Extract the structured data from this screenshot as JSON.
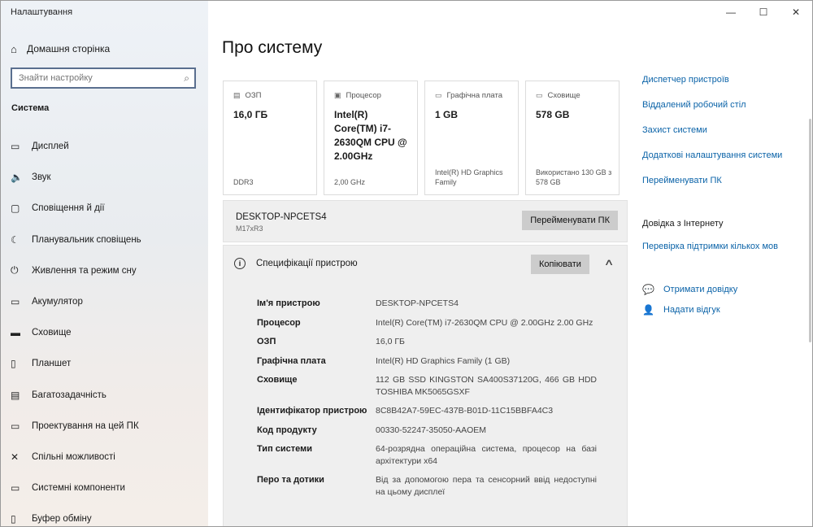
{
  "app": {
    "title": "Налаштування"
  },
  "window_controls": {
    "minimize": "—",
    "maximize": "☐",
    "close": "✕"
  },
  "sidebar": {
    "home_label": "Домашня сторінка",
    "search_placeholder": "Знайти настройку",
    "section_title": "Система",
    "items": [
      {
        "label": "Дисплей",
        "icon": "display-icon",
        "glyph": "▭"
      },
      {
        "label": "Звук",
        "icon": "sound-icon",
        "glyph": "🔈"
      },
      {
        "label": "Сповіщення й дії",
        "icon": "notifications-icon",
        "glyph": "▢"
      },
      {
        "label": "Планувальник сповіщень",
        "icon": "focus-assist-icon",
        "glyph": "☾"
      },
      {
        "label": "Живлення та режим сну",
        "icon": "power-icon",
        "glyph": "⏻"
      },
      {
        "label": "Акумулятор",
        "icon": "battery-icon",
        "glyph": "▭"
      },
      {
        "label": "Сховище",
        "icon": "storage-icon",
        "glyph": "▬"
      },
      {
        "label": "Планшет",
        "icon": "tablet-icon",
        "glyph": "▯"
      },
      {
        "label": "Багатозадачність",
        "icon": "multitasking-icon",
        "glyph": "▤"
      },
      {
        "label": "Проектування на цей ПК",
        "icon": "projecting-icon",
        "glyph": "▭"
      },
      {
        "label": "Спільні можливості",
        "icon": "shared-experiences-icon",
        "glyph": "✕"
      },
      {
        "label": "Системні компоненти",
        "icon": "system-components-icon",
        "glyph": "▭"
      },
      {
        "label": "Буфер обміну",
        "icon": "clipboard-icon",
        "glyph": "▯"
      }
    ]
  },
  "main": {
    "title": "Про систему",
    "cards": [
      {
        "label": "ОЗП",
        "value": "16,0 ГБ",
        "sub": "DDR3",
        "icon": "ram-icon",
        "glyph": "▤"
      },
      {
        "label": "Процесор",
        "value": "Intel(R) Core(TM) i7-2630QM CPU @ 2.00GHz",
        "sub": "2,00 GHz",
        "icon": "processor-icon",
        "glyph": "▣"
      },
      {
        "label": "Графічна плата",
        "value": "1 GB",
        "sub": "Intel(R) HD Graphics Family",
        "icon": "graphics-icon",
        "glyph": "▭"
      },
      {
        "label": "Сховище",
        "value": "578 GB",
        "sub": "Використано 130 GB з 578 GB",
        "icon": "storage-icon",
        "glyph": "▭"
      }
    ],
    "device": {
      "name": "DESKTOP-NPCETS4",
      "model": "M17xR3",
      "rename_label": "Перейменувати ПК"
    },
    "specs": {
      "title": "Специфікації пристрою",
      "copy_label": "Копіювати",
      "rows": [
        {
          "key": "Ім'я пристрою",
          "value": "DESKTOP-NPCETS4"
        },
        {
          "key": "Процесор",
          "value": "Intel(R) Core(TM) i7-2630QM CPU @ 2.00GHz 2.00 GHz"
        },
        {
          "key": "ОЗП",
          "value": "16,0 ГБ"
        },
        {
          "key": "Графічна плата",
          "value": "Intel(R) HD Graphics Family (1 GB)"
        },
        {
          "key": "Сховище",
          "value": "112 GB SSD KINGSTON SA400S37120G, 466 GB HDD TOSHIBA MK5065GSXF"
        },
        {
          "key": "Ідентифікатор пристрою",
          "value": "8C8B42A7-59EC-437B-B01D-11C15BBFA4C3"
        },
        {
          "key": "Код продукту",
          "value": "00330-52247-35050-AAOEM"
        },
        {
          "key": "Тип системи",
          "value": "64-розрядна операційна система, процесор на базі архітектури x64"
        },
        {
          "key": "Перо та дотики",
          "value": "Від за допомогою пера та сенсорний ввід недоступні на цьому дисплеї"
        }
      ]
    }
  },
  "right": {
    "links": [
      "Диспетчер пристроїв",
      "Віддалений робочий стіл",
      "Захист системи",
      "Додаткові налаштування системи",
      "Перейменувати ПК"
    ],
    "help_title": "Довідка з Інтернету",
    "help_link": "Перевірка підтримки кількох мов",
    "get_help": "Отримати довідку",
    "feedback": "Надати відгук"
  }
}
